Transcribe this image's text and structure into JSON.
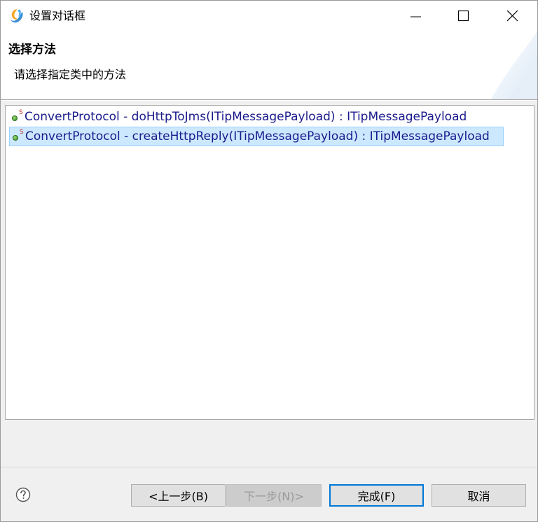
{
  "window": {
    "title": "设置对话框",
    "app_icon": "swirl-logo-icon"
  },
  "banner": {
    "title": "选择方法",
    "description": "请选择指定类中的方法"
  },
  "list": {
    "items": [
      {
        "icon": "public-static-method-icon",
        "badge": "S",
        "label": "ConvertProtocol - doHttpToJms(ITipMessagePayload) : ITipMessagePayload",
        "selected": false
      },
      {
        "icon": "public-static-method-icon",
        "badge": "S",
        "label": "ConvertProtocol - createHttpReply(ITipMessagePayload) : ITipMessagePayload",
        "selected": true
      }
    ]
  },
  "buttons": {
    "back": "<上一步(B)",
    "next": "下一步(N)>",
    "finish": "完成(F)",
    "cancel": "取消"
  },
  "colors": {
    "selection_bg": "#cce8ff",
    "item_text": "#1a1a8c",
    "default_button_border": "#0078d7"
  }
}
